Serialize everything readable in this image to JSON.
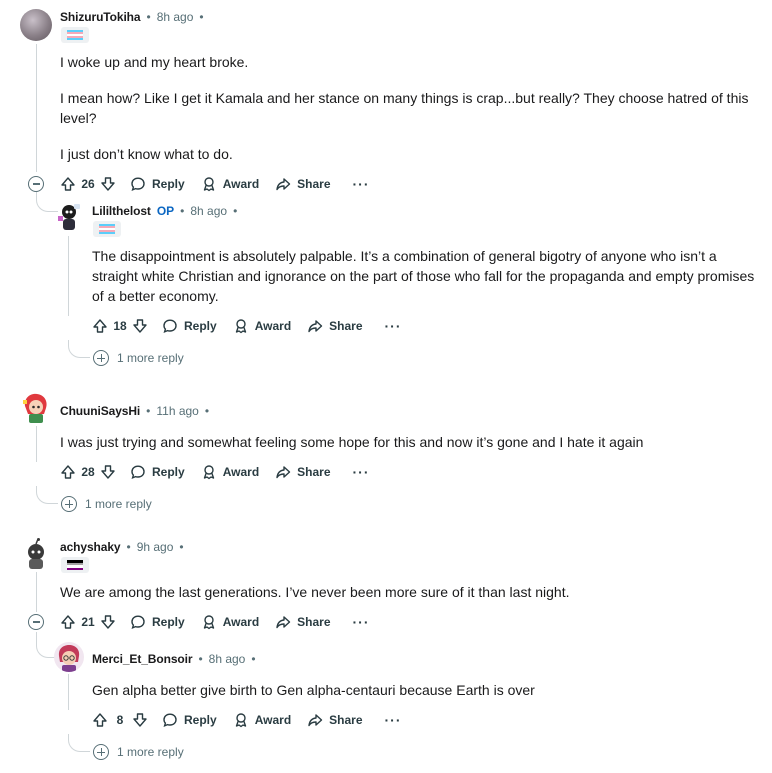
{
  "comments": [
    {
      "username": "ShizuruTokiha",
      "time": "8h ago",
      "flair": "trans-flag",
      "body": [
        "I woke up and my heart broke.",
        "I mean how? Like I get it Kamala and her stance on many things is crap...but really? They choose hatred of this level?",
        "I just don’t know what to do."
      ],
      "votes": "26",
      "replies": [
        {
          "username": "Lililthelost",
          "op_label": "OP",
          "time": "8h ago",
          "flair": "trans-flag",
          "body": [
            "The disappointment is absolutely palpable. It’s a combination of general bigotry of anyone who isn’t a straight white Christian and ignorance on the part of those who fall for the propaganda and empty promises of a better economy."
          ],
          "votes": "18",
          "more_replies": "1 more reply"
        }
      ]
    },
    {
      "username": "ChuuniSaysHi",
      "time": "11h ago",
      "body": [
        "I was just trying and somewhat feeling some hope for this and now it’s gone and I hate it again"
      ],
      "votes": "28",
      "more_replies": "1 more reply"
    },
    {
      "username": "achyshaky",
      "time": "9h ago",
      "flair": "ace-flag",
      "body": [
        "We are among the last generations. I’ve never been more sure of it than last night."
      ],
      "votes": "21",
      "replies": [
        {
          "username": "Merci_Et_Bonsoir",
          "time": "8h ago",
          "body": [
            "Gen alpha better give birth to Gen alpha-centauri because Earth is over"
          ],
          "votes": "8",
          "more_replies": "1 more reply"
        }
      ]
    }
  ],
  "labels": {
    "reply": "Reply",
    "award": "Award",
    "share": "Share",
    "more": "···",
    "dot": "•"
  },
  "colors": {
    "thread_line": "#d0d6d9",
    "meta": "#576f76",
    "op": "#0a66c2"
  }
}
